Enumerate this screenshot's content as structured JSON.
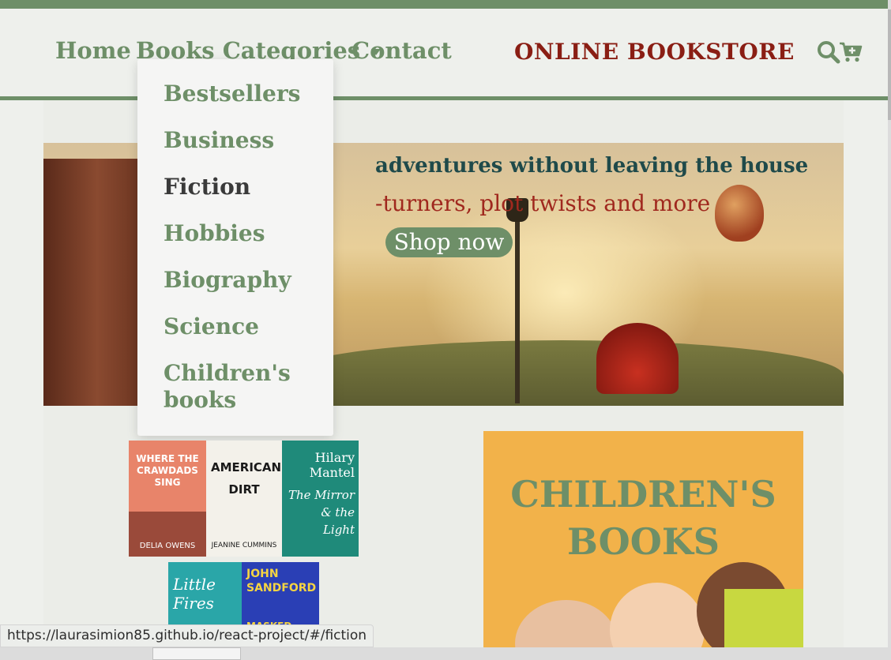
{
  "nav": {
    "home": "Home",
    "categories": "Books Categories",
    "contact": "Contact",
    "brand": "ONLINE BOOKSTORE"
  },
  "icons": {
    "search": "search-icon",
    "cart": "cart-plus-icon",
    "caret": "caret-down-icon"
  },
  "dropdown": {
    "items": [
      "Bestsellers",
      "Business",
      "Fiction",
      "Hobbies",
      "Biography",
      "Science",
      "Children's books"
    ],
    "active": "Fiction"
  },
  "hero": {
    "title": "adventures without leaving the house",
    "subtitle": "-turners, plot twists and more",
    "button": "Shop now"
  },
  "books": [
    {
      "title": "WHERE THE CRAWDADS SING",
      "author": "DELIA OWENS",
      "color": "#e8846a"
    },
    {
      "title": "AMERICAN DIRT",
      "author": "JEANINE CUMMINS",
      "color": "#f3f1ea"
    },
    {
      "title": "The Mirror & the Light",
      "author": "Hilary Mantel",
      "color": "#1f8a7a"
    },
    {
      "title": "Little Fires",
      "author": "",
      "color": "#2aa6a8"
    },
    {
      "title": "MASKED",
      "author": "JOHN SANDFORD",
      "color": "#2a3fb5"
    }
  ],
  "promo": {
    "title": "CHILDREN'S BOOKS"
  },
  "status": {
    "url": "https://laurasimion85.github.io/react-project/#/fiction"
  },
  "colors": {
    "accent": "#6e8f68",
    "brand": "#8a1e14",
    "hero_title": "#1f4a4a",
    "hero_sub": "#a0281e",
    "promo_bg": "#f2b24a"
  }
}
